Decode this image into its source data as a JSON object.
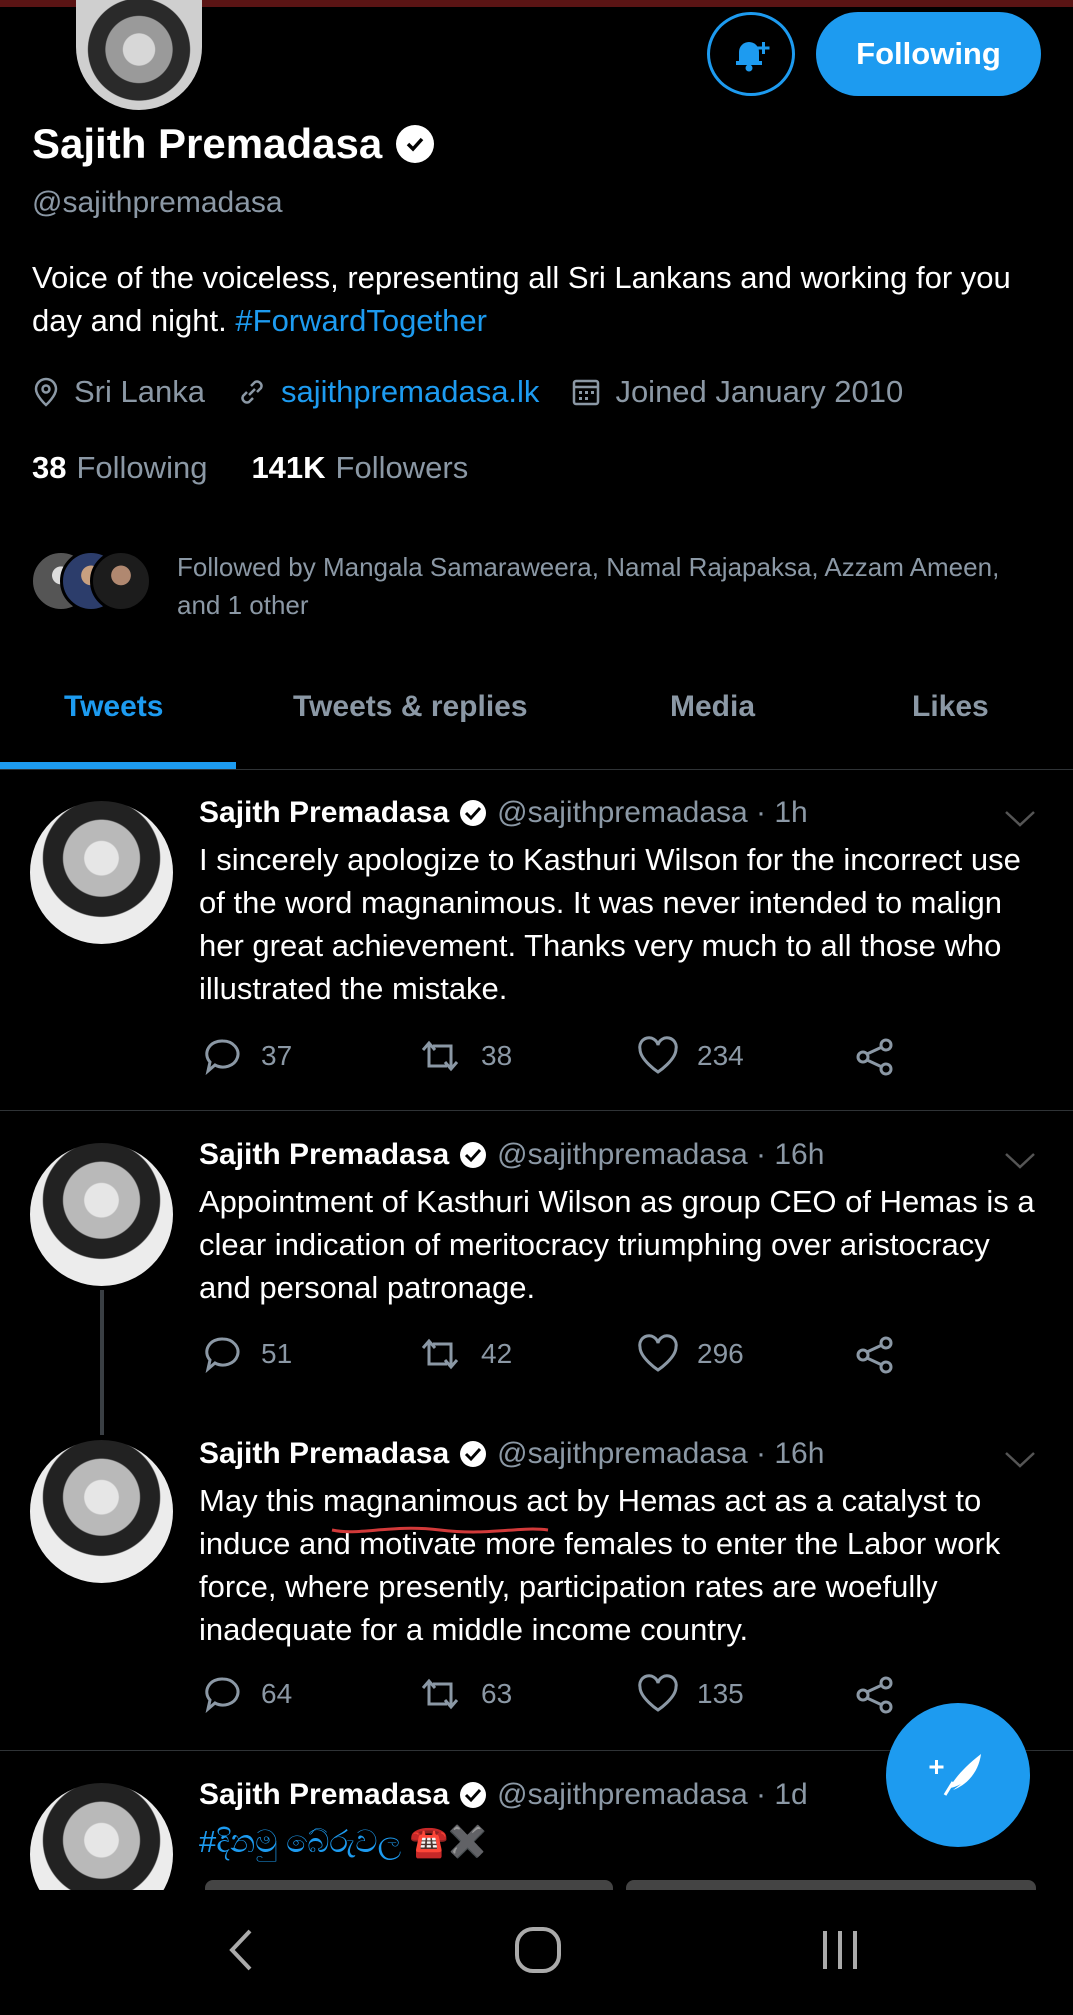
{
  "profile": {
    "name": "Sajith Premadasa",
    "handle": "@sajithpremadasa",
    "bio_text": "Voice of the voiceless, representing all Sri Lankans and working for you day and night. ",
    "bio_hashtag": "#ForwardTogether",
    "location": "Sri Lanka",
    "website": "sajithpremadasa.lk",
    "joined": "Joined January 2010",
    "following_count": "38",
    "following_label": "Following",
    "followers_count": "141K",
    "followers_label": "Followers",
    "followed_by": "Followed by Mangala Samaraweera, Namal Rajapaksa, Azzam Ameen, and 1 other",
    "follow_button": "Following"
  },
  "tabs": [
    "Tweets",
    "Tweets & replies",
    "Media",
    "Likes"
  ],
  "tweets": [
    {
      "name": "Sajith Premadasa",
      "meta": "@sajithpremadasa · 1h",
      "text": "I sincerely apologize to Kasthuri Wilson for the incorrect use of the word magnanimous. It was never intended to malign her great achievement. Thanks very much to all those who illustrated the mistake.",
      "replies": "37",
      "retweets": "38",
      "likes": "234"
    },
    {
      "name": "Sajith Premadasa",
      "meta": "@sajithpremadasa · 16h",
      "text": "Appointment of Kasthuri Wilson as group CEO of Hemas is a clear indication of meritocracy triumphing over aristocracy and personal patronage.",
      "replies": "51",
      "retweets": "42",
      "likes": "296"
    },
    {
      "name": "Sajith Premadasa",
      "meta": "@sajithpremadasa · 16h",
      "text": "May this magnanimous act by Hemas act as a catalyst to induce and motivate more females to enter the Labor work force, where presently, participation rates are woefully inadequate for a middle income country.",
      "replies": "64",
      "retweets": "63",
      "likes": "135"
    },
    {
      "name": "Sajith Premadasa",
      "meta": "@sajithpremadasa · 1d",
      "text": "#දිනමු බේරුවල ☎️✖️"
    }
  ],
  "colors": {
    "accent": "#1d9bf0",
    "secondary_text": "#8b98a5",
    "background": "#000000"
  }
}
